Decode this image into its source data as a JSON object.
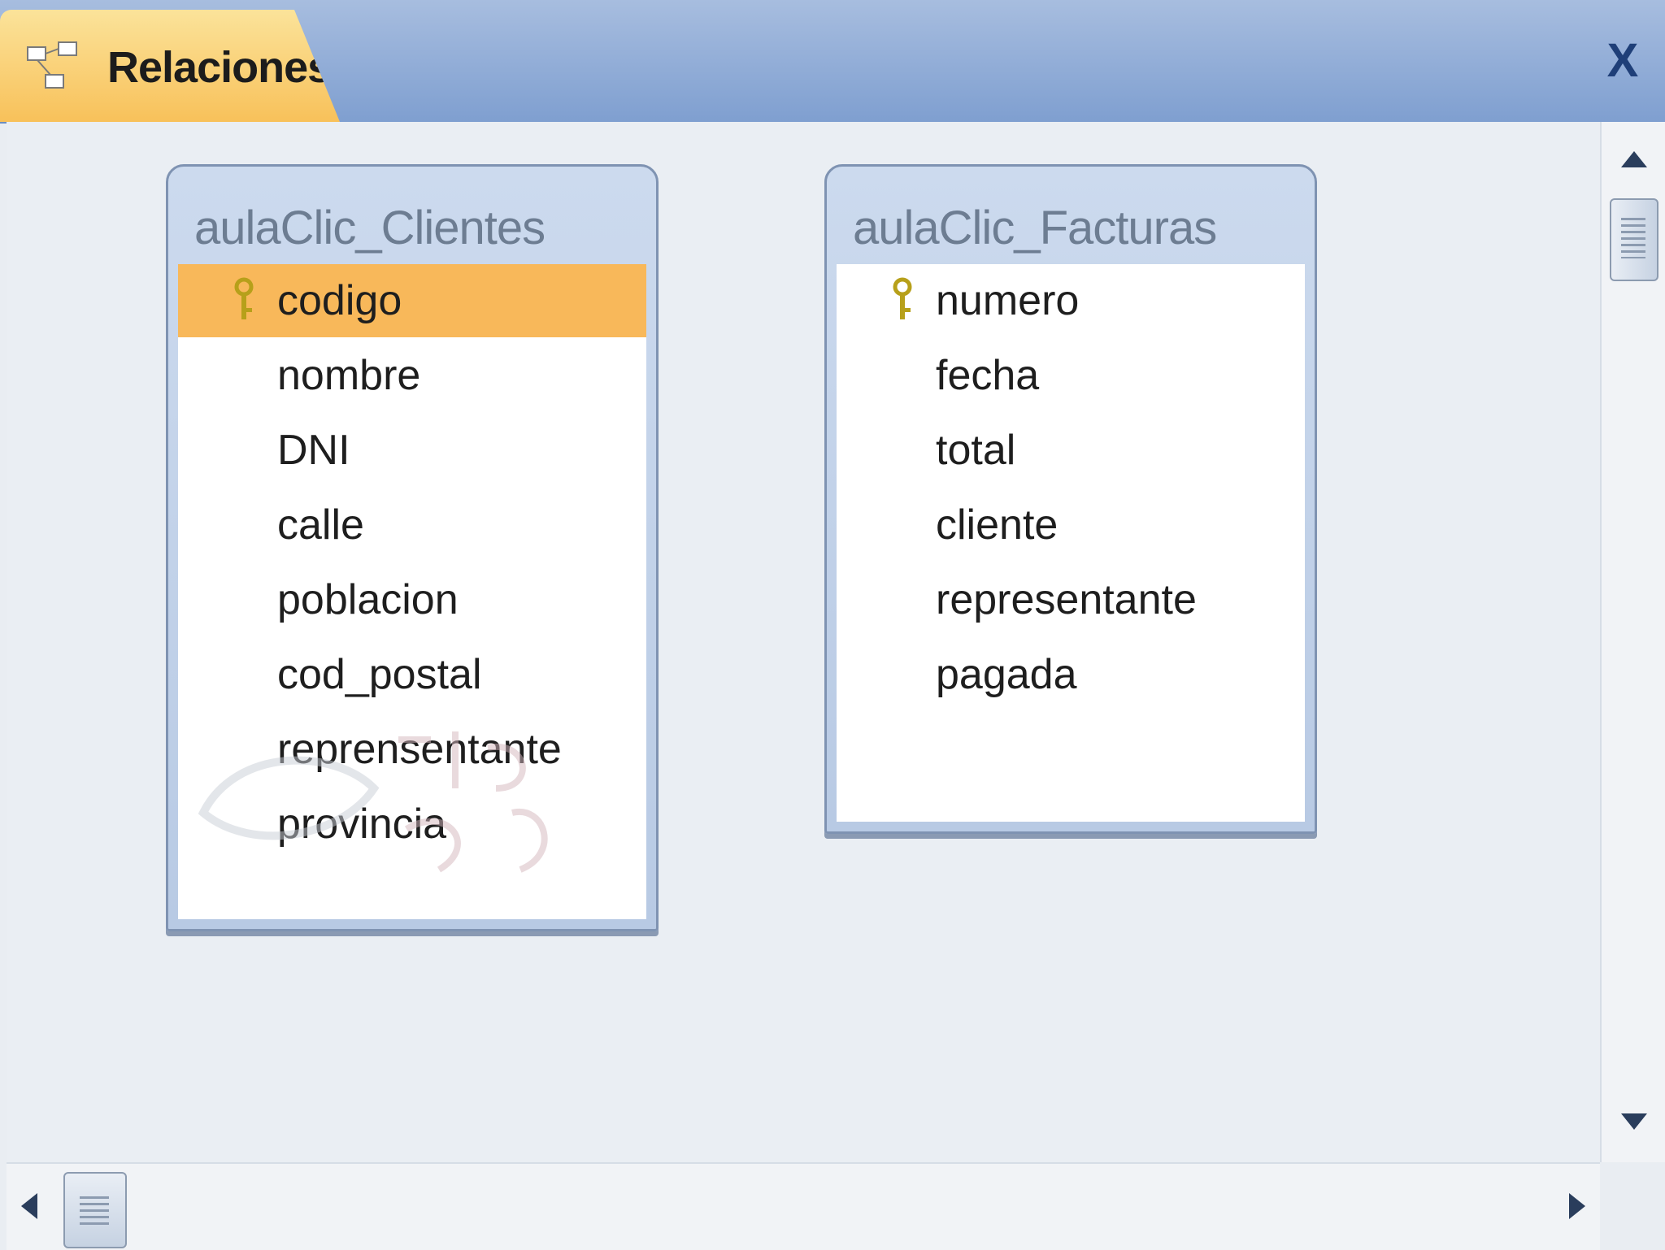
{
  "tab": {
    "label": "Relaciones",
    "icon": "relationships-icon",
    "close_label": "X"
  },
  "tables": [
    {
      "title": "aulaClic_Clientes",
      "fields": [
        {
          "name": "codigo",
          "primary_key": true,
          "selected": true
        },
        {
          "name": "nombre"
        },
        {
          "name": "DNI"
        },
        {
          "name": "calle"
        },
        {
          "name": "poblacion"
        },
        {
          "name": "cod_postal"
        },
        {
          "name": "reprensentante"
        },
        {
          "name": "provincia"
        }
      ]
    },
    {
      "title": "aulaClic_Facturas",
      "fields": [
        {
          "name": "numero",
          "primary_key": true
        },
        {
          "name": "fecha"
        },
        {
          "name": "total"
        },
        {
          "name": "cliente"
        },
        {
          "name": "representante"
        },
        {
          "name": "pagada"
        }
      ]
    }
  ],
  "colors": {
    "tab_bar": "#8fabd7",
    "active_tab": "#f8c15a",
    "selected_field": "#f8b85a",
    "key_icon": "#b7a01a"
  }
}
